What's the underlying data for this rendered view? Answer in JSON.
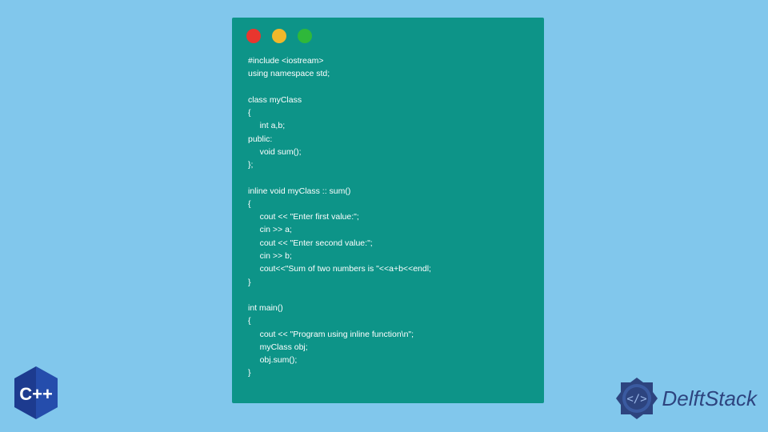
{
  "traffic_lights": {
    "red": "#e8362e",
    "yellow": "#f0b82b",
    "green": "#2fb83a"
  },
  "code": "#include <iostream>\nusing namespace std;\n\nclass myClass\n{\n     int a,b;\npublic:\n     void sum();\n};\n\ninline void myClass :: sum()\n{\n     cout << \"Enter first value:\";\n     cin >> a;\n     cout << \"Enter second value:\";\n     cin >> b;\n     cout<<\"Sum of two numbers is \"<<a+b<<endl;\n}\n\nint main()\n{\n     cout << \"Program using inline function\\n\";\n     myClass obj;\n     obj.sum();\n}",
  "cpp_badge": {
    "label": "C++"
  },
  "brand": {
    "name": "DelftStack"
  },
  "colors": {
    "page_bg": "#81c7ec",
    "window_bg": "#0d9488",
    "code_text": "#ffffff",
    "cpp_badge": "#1d3b8f",
    "brand_text": "#2d447f",
    "brand_seal": "#2d447f"
  }
}
